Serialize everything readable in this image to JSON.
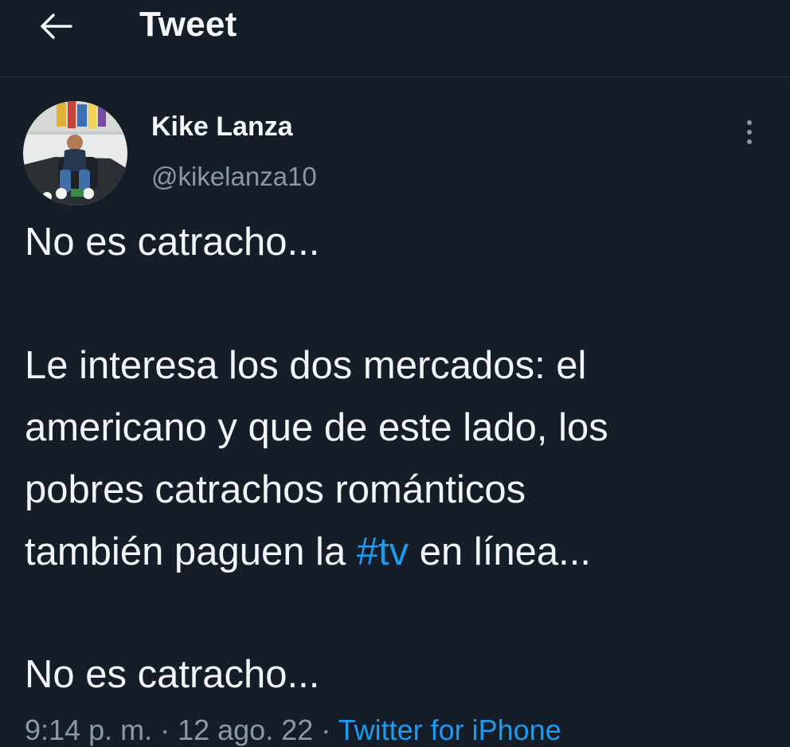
{
  "header": {
    "back_icon": "arrow-left-icon",
    "title": "Tweet"
  },
  "author": {
    "display_name": "Kike Lanza",
    "handle": "@kikelanza10",
    "avatar_icon": "profile-photo",
    "more_icon": "more-vertical-icon"
  },
  "tweet": {
    "line1": "No es catracho...",
    "line2": "Le interesa los dos mercados: el",
    "line3": "americano y que de este lado, los",
    "line4": "pobres catrachos románticos",
    "line5_before": "también paguen la ",
    "line5_hashtag": "#tv",
    "line5_after": " en línea...",
    "line6": "No es catracho..."
  },
  "meta": {
    "time": "9:14 p. m.",
    "separator": " · ",
    "date": "12 ago. 22",
    "source": "Twitter for iPhone"
  },
  "colors": {
    "background": "#151d28",
    "text": "#f2f4f6",
    "secondary": "#8b98a5",
    "accent": "#1d9bf0"
  }
}
